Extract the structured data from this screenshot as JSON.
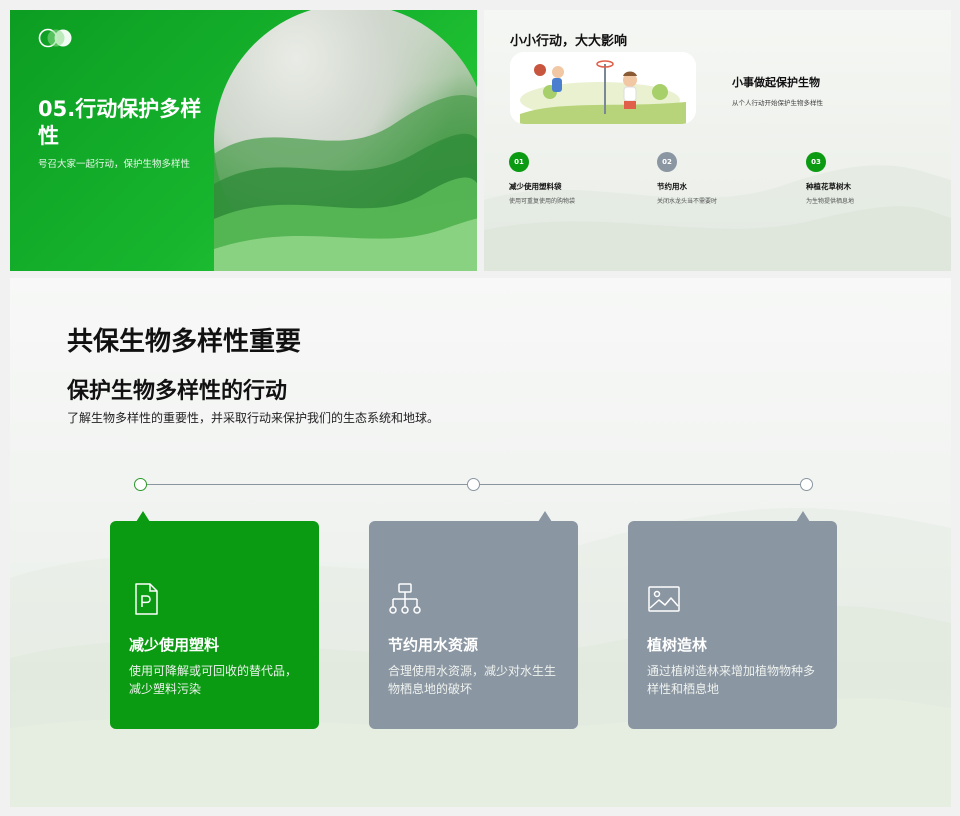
{
  "slide1": {
    "title": "05.行动保护多样性",
    "subtitle": "号召大家一起行动，保护生物多样性"
  },
  "slide2": {
    "heading": "小小行动，大大影响",
    "side_title": "小事做起保护生物",
    "side_subtitle": "从个人行动开始保护生物多样性",
    "steps": [
      {
        "num": "01",
        "title": "减少使用塑料袋",
        "desc": "使用可重复使用的购物袋",
        "color": "#0b9b12"
      },
      {
        "num": "02",
        "title": "节约用水",
        "desc": "关闭水龙头当不需要时",
        "color": "#8b96a3"
      },
      {
        "num": "03",
        "title": "种植花草树木",
        "desc": "为生物提供栖息地",
        "color": "#0b9b12"
      }
    ]
  },
  "slide3": {
    "main_title": "共保生物多样性重要",
    "sub_title": "保护生物多样性的行动",
    "description": "了解生物多样性的重要性，并采取行动来保护我们的生态系统和地球。",
    "cards": [
      {
        "icon": "document-p-icon",
        "title": "减少使用塑料",
        "desc": "使用可降解或可回收的替代品，减少塑料污染",
        "active": true
      },
      {
        "icon": "hierarchy-icon",
        "title": "节约用水资源",
        "desc": "合理使用水资源，减少对水生生物栖息地的破坏",
        "active": false
      },
      {
        "icon": "image-icon",
        "title": "植树造林",
        "desc": "通过植树造林来增加植物物种多样性和栖息地",
        "active": false
      }
    ]
  },
  "colors": {
    "accent_green": "#0b9b12",
    "gray_card": "#8b96a3"
  }
}
